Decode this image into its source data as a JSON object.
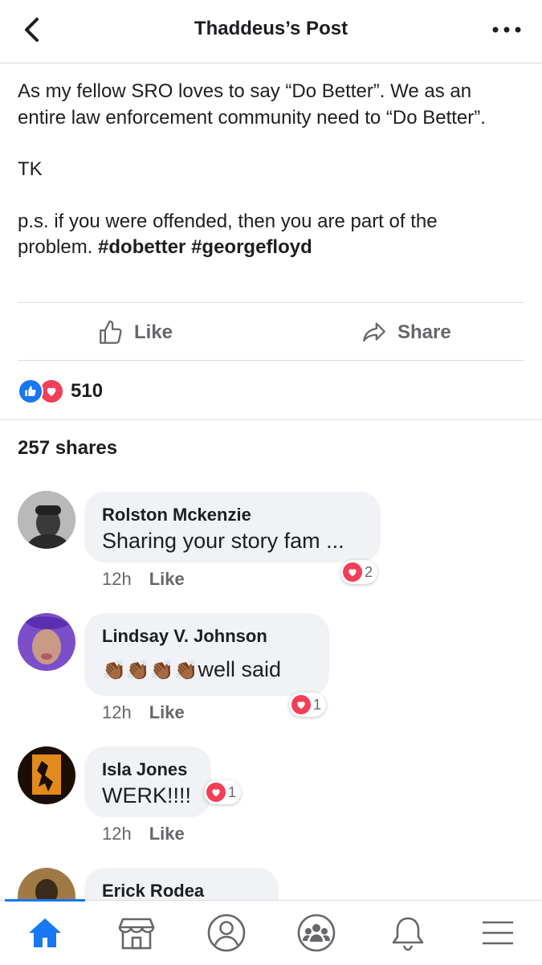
{
  "header": {
    "title": "Thaddeus’s Post",
    "back_icon": "chevron-left-icon",
    "more_icon": "more-dots-icon"
  },
  "post": {
    "line1": "As my fellow SRO loves to say “Do Better”. We as an entire law enforcement community need to “Do Better”.",
    "signature": "TK",
    "ps_text": "p.s. if you were offended, then you are part of the problem.",
    "hashtag1": "#dobetter",
    "hashtag2": "#georgefloyd"
  },
  "actions": {
    "like_label": "Like",
    "share_label": "Share"
  },
  "reactions": {
    "count": "510"
  },
  "shares": {
    "label": "257 shares"
  },
  "comments": [
    {
      "name": "Rolston Mckenzie",
      "text": "Sharing your story fam ...",
      "time": "12h",
      "like_label": "Like",
      "reaction_count": "2"
    },
    {
      "name": "Lindsay V. Johnson",
      "text": "well said",
      "emoji": "👏🏾👏🏾👏🏾👏🏾",
      "time": "12h",
      "like_label": "Like",
      "reaction_count": "1"
    },
    {
      "name": "Isla Jones",
      "text": "WERK!!!!",
      "time": "12h",
      "like_label": "Like",
      "reaction_count": "1"
    },
    {
      "name": "Erick Rodea"
    }
  ],
  "tabs": [
    "home-icon",
    "marketplace-icon",
    "profile-icon",
    "groups-icon",
    "notifications-icon",
    "menu-icon"
  ],
  "colors": {
    "accent": "#1877f2",
    "love": "#f33e58",
    "bubble": "#f0f2f5",
    "muted": "#65676b"
  }
}
